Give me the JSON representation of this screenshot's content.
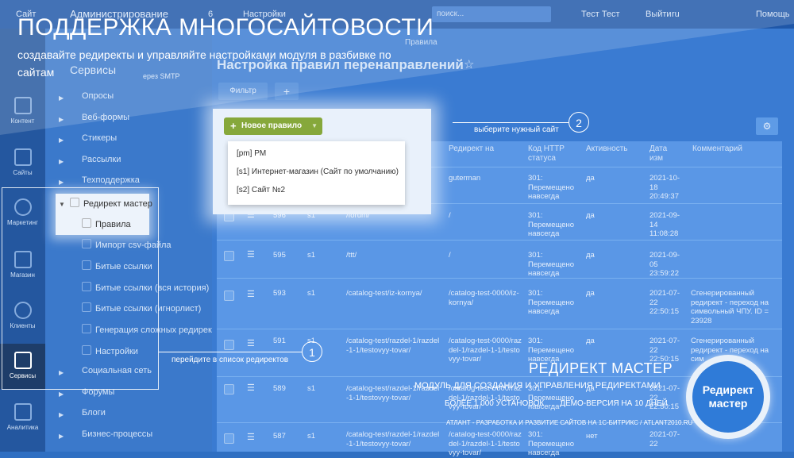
{
  "topbar": {
    "site_label": "Сайт",
    "admin_label": "Администрирование",
    "counter": "6",
    "settings_label": "Настройки",
    "search_placeholder": "поиск...",
    "user_name": "Тест Тест",
    "logout_label": "Выйти",
    "lang": "ru",
    "help_label": "Помощь"
  },
  "leftnav": [
    {
      "label": "Контент",
      "icon": "document-icon"
    },
    {
      "label": "Сайты",
      "icon": "calendar-icon"
    },
    {
      "label": "Маркетинг",
      "icon": "target-icon"
    },
    {
      "label": "Магазин",
      "icon": "basket-icon"
    },
    {
      "label": "Клиенты",
      "icon": "users-icon"
    },
    {
      "label": "Сервисы",
      "icon": "layers-icon"
    },
    {
      "label": "Аналитика",
      "icon": "bar-chart-icon"
    }
  ],
  "sidebar": {
    "items": [
      {
        "label": "Сервисы"
      },
      {
        "label": "Опросы"
      },
      {
        "label": "Веб-формы"
      },
      {
        "label": "Стикеры"
      },
      {
        "label": "Рассылки"
      },
      {
        "label": "Техподдержка"
      },
      {
        "label": "Редирект мастер"
      },
      {
        "label": "Правила"
      },
      {
        "label": "Импорт csv-файла"
      },
      {
        "label": "Битые ссылки"
      },
      {
        "label": "Битые ссылки (вся история)"
      },
      {
        "label": "Битые ссылки (игнорлист)"
      },
      {
        "label": "Генерация сложных редиректо"
      },
      {
        "label": "Настройки"
      },
      {
        "label": "Социальная сеть"
      },
      {
        "label": "Форумы"
      },
      {
        "label": "Блоги"
      },
      {
        "label": "Бизнес-процессы"
      }
    ],
    "smtp_hint": "ерез SMTP"
  },
  "page": {
    "breadcrumb": "Правила",
    "title": "Настройка правил перенаправлений",
    "filter_label": "Фильтр"
  },
  "new_rule_button": "Новое правило",
  "dropdown": [
    {
      "label": "[pm] PM"
    },
    {
      "label": "[s1] Интернет-магазин (Сайт по умолчанию)"
    },
    {
      "label": "[s2] Сайт №2"
    }
  ],
  "table": {
    "columns": [
      "Редирект на",
      "Код HTTP статуса",
      "Активность",
      "Дата изм",
      "Комментарий"
    ],
    "rows": [
      {
        "id": "",
        "site": "",
        "from": "",
        "to": "guterman",
        "code": "301: Перемещено навсегда",
        "active": "да",
        "date": "2021-10-18 20:49:37",
        "comment": ""
      },
      {
        "id": "596",
        "site": "s1",
        "from": "/forum/",
        "to": "/",
        "code": "301: Перемещено навсегда",
        "active": "да",
        "date": "2021-09-14 11:08:28",
        "comment": ""
      },
      {
        "id": "595",
        "site": "s1",
        "from": "/ttt/",
        "to": "/",
        "code": "301: Перемещено навсегда",
        "active": "да",
        "date": "2021-09-05 23:59:22",
        "comment": ""
      },
      {
        "id": "593",
        "site": "s1",
        "from": "/catalog-test/iz-kornya/",
        "to": "/catalog-test-0000/iz-kornya/",
        "code": "301: Перемещено навсегда",
        "active": "да",
        "date": "2021-07-22 22:50:15",
        "comment": "Сгенерированный редирект - переход на символьный ЧПУ. ID = 23928"
      },
      {
        "id": "591",
        "site": "s1",
        "from": "/catalog-test/razdel-1/razdel-1-1/testovyy-tovar/",
        "to": "/catalog-test-0000/razdel-1/razdel-1-1/testovyy-tovar/",
        "code": "301: Перемещено навсегда",
        "active": "да",
        "date": "2021-07-22 22:50:15",
        "comment": "Сгенерированный редирект - переход на сим"
      },
      {
        "id": "589",
        "site": "s1",
        "from": "/catalog-test/razdel-1/razdel-1-1/testovyy-tovar/",
        "to": "/catalog-test-0000/razdel-1/razdel-1-1/testovyy-tovar/",
        "code": "301: Перемещено навсегда",
        "active": "да",
        "date": "2021-07-22 22:50:15",
        "comment": ""
      },
      {
        "id": "587",
        "site": "s1",
        "from": "/catalog-test/razdel-1/razdel-1-1/testovyy-tovar/",
        "to": "/catalog-test-0000/razdel-1/razdel-1-1/testovyy-tovar/",
        "code": "301: Перемещено навсегда",
        "active": "нет",
        "date": "2021-07-22",
        "comment": ""
      }
    ]
  },
  "promo": {
    "title": "ПОДДЕРЖКА МНОГОСАЙТОВОСТИ",
    "subtitle": "создавайте редиректы и управляйте настройками модуля в разбивке по сайтам",
    "callout1": "перейдите в список редиректов",
    "callout1_num": "1",
    "callout2": "выберите нужный сайт",
    "callout2_num": "2",
    "product_title": "РЕДИРЕКТ МАСТЕР",
    "product_desc": "МОДУЛЬ ДЛЯ СОЗДАНИЯ И УПРАВЛЕНИЯ РЕДИРЕКТАМИ",
    "installs": "БОЛЕЕ 1 000 УСТАНОВОК",
    "demo": "ДЕМО-ВЕРСИЯ НА 10 ДНЕЙ",
    "footer": "АТЛАНТ - РАЗРАБОТКА И РАЗВИТИЕ САЙТОВ НА 1С-БИТРИКС / ATLANT2010.RU",
    "badge": "Редирект мастер"
  }
}
